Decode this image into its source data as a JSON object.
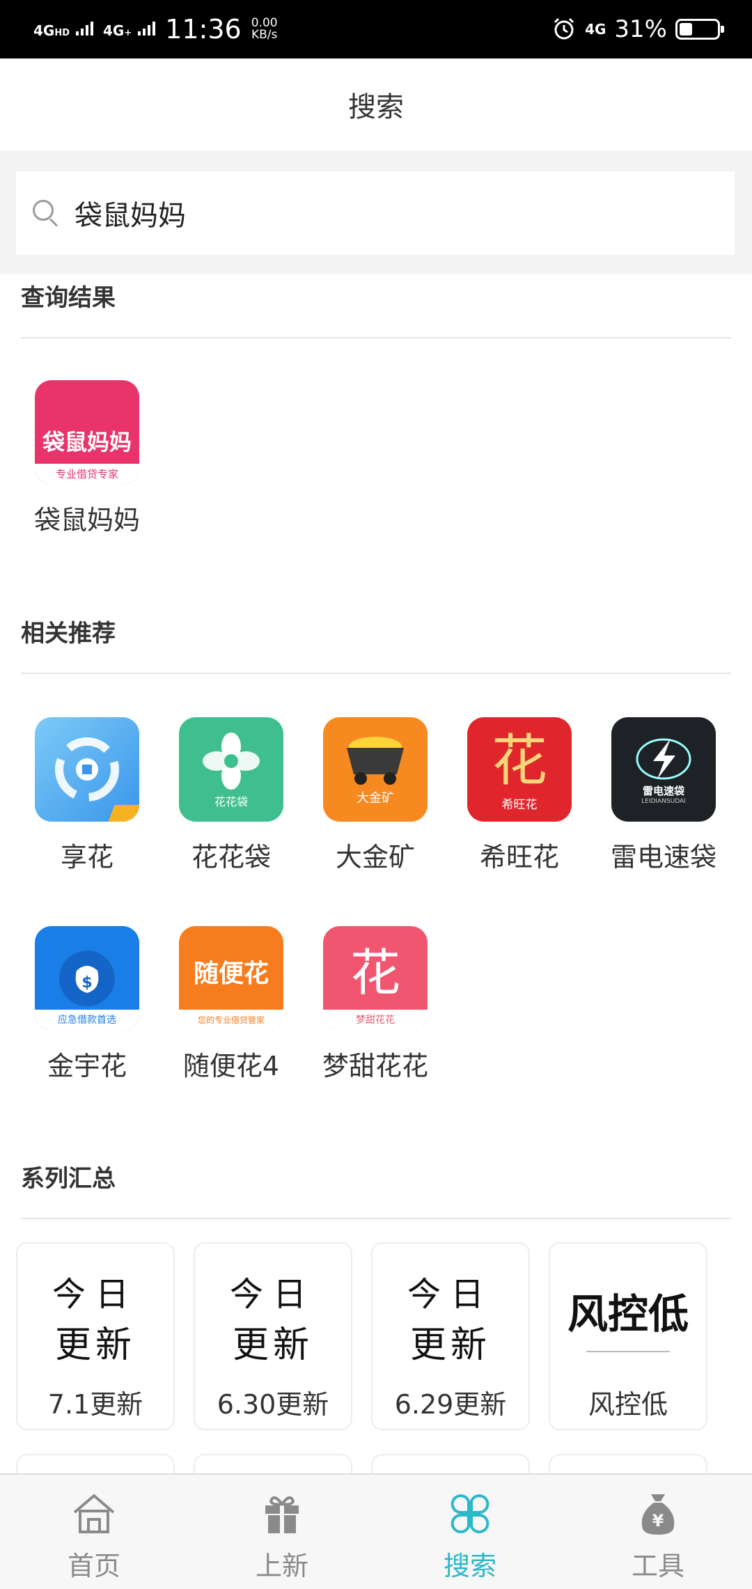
{
  "status_bar": {
    "signal1": "4G",
    "signal1_sup": "HD",
    "signal2": "4G",
    "signal2_sup": "+",
    "time": "11:36",
    "speed_value": "0.00",
    "speed_unit": "KB/s",
    "signal3": "4G",
    "battery_percent": "31%",
    "battery_level": 0.31
  },
  "header": {
    "title": "搜索"
  },
  "search": {
    "value": "袋鼠妈妈"
  },
  "results": {
    "title": "查询结果",
    "items": [
      {
        "label": "袋鼠妈妈",
        "icon_text": "袋鼠妈妈",
        "icon_sub": "专业借贷专家",
        "color": "#e8336b"
      }
    ]
  },
  "recommend": {
    "title": "相关推荐",
    "items": [
      {
        "label": "享花",
        "color": "#4aa8f0",
        "icon": "xianghua-app-icon"
      },
      {
        "label": "花花袋",
        "icon_sub": "花花袋",
        "color": "#3fbf90",
        "icon": "huahuadai-app-icon"
      },
      {
        "label": "大金矿",
        "icon_sub": "大金矿",
        "color": "#f6891f",
        "icon": "dajinkuang-app-icon"
      },
      {
        "label": "希旺花",
        "icon_text": "花",
        "icon_sub": "希旺花",
        "color": "#e0262c",
        "icon": "xiwanghua-app-icon"
      },
      {
        "label": "雷电速袋",
        "icon_text": "雷电速袋",
        "icon_sub": "LEIDIANSUDAI",
        "color": "#1e2226",
        "icon": "leidiansudai-app-icon"
      },
      {
        "label": "金宇花",
        "icon_sub": "应急借款首选",
        "color": "#1a7ee8",
        "icon": "jinyuhua-app-icon"
      },
      {
        "label": "随便花4",
        "icon_text": "随便花",
        "icon_sub": "您的专业借贷管家",
        "color": "#f67c1e",
        "icon": "suibianhua-app-icon"
      },
      {
        "label": "梦甜花花",
        "icon_text": "花",
        "icon_sub": "梦甜花花",
        "color": "#f0566f",
        "icon": "mengtianhuahua-app-icon"
      }
    ]
  },
  "series": {
    "title": "系列汇总",
    "items": [
      {
        "line1": "今日",
        "line2": "更新",
        "label": "7.1更新"
      },
      {
        "line1": "今日",
        "line2": "更新",
        "label": "6.30更新"
      },
      {
        "line1": "今日",
        "line2": "更新",
        "label": "6.29更新"
      },
      {
        "big": "风控低",
        "label": "风控低"
      }
    ]
  },
  "nav": {
    "items": [
      {
        "label": "首页",
        "icon": "home-icon"
      },
      {
        "label": "上新",
        "icon": "gift-icon"
      },
      {
        "label": "搜索",
        "icon": "clover-icon",
        "active": true
      },
      {
        "label": "工具",
        "icon": "money-bag-icon"
      }
    ],
    "active_color": "#2bb8c8"
  }
}
